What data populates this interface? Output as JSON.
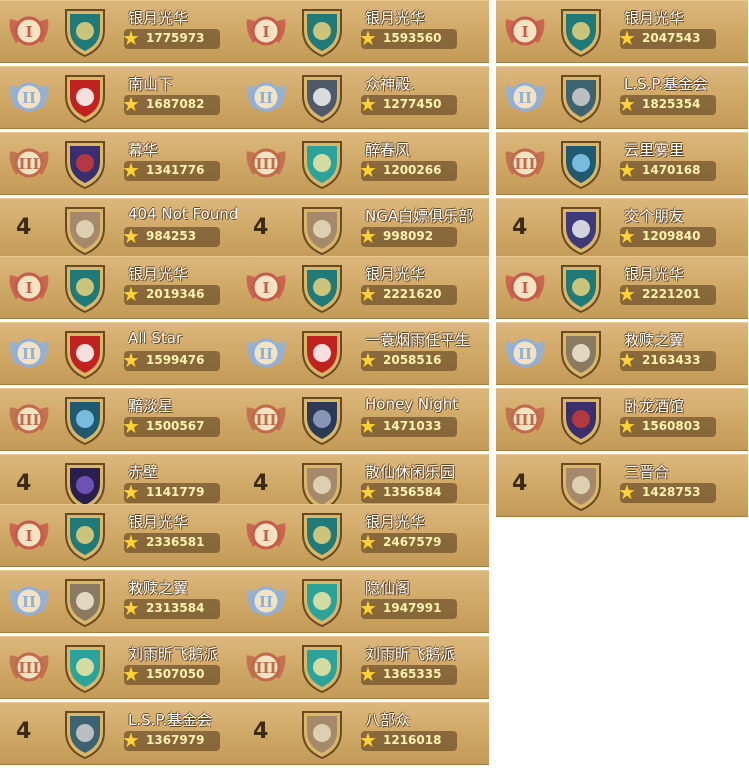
{
  "panels": [
    {
      "rows": [
        {
          "rank": "1",
          "name": "银月光华",
          "score": "1775973",
          "crest": "witch-crest"
        },
        {
          "rank": "2",
          "name": "南山下",
          "score": "1687082",
          "crest": "dragon-crest"
        },
        {
          "rank": "3",
          "name": "幕华",
          "score": "1341776",
          "crest": "flame-crest"
        },
        {
          "rank": "4",
          "name": "404 Not Found",
          "score": "984253",
          "crest": "crown-crest"
        }
      ]
    },
    {
      "rows": [
        {
          "rank": "1",
          "name": "银月光华",
          "score": "1593560",
          "crest": "witch-crest"
        },
        {
          "rank": "2",
          "name": "众神殿.",
          "score": "1277450",
          "crest": "panda-crest"
        },
        {
          "rank": "3",
          "name": "醉春风",
          "score": "1200266",
          "crest": "harp-crest"
        },
        {
          "rank": "4",
          "name": "NGA白嫖俱乐部",
          "score": "998092",
          "crest": "crown-crest"
        }
      ]
    },
    {
      "rows": [
        {
          "rank": "1",
          "name": "银月光华",
          "score": "2047543",
          "crest": "witch-crest"
        },
        {
          "rank": "2",
          "name": "L.S.P.基金会",
          "score": "1825354",
          "crest": "knight-crest"
        },
        {
          "rank": "3",
          "name": "云里雾里",
          "score": "1470168",
          "crest": "flower-crest"
        },
        {
          "rank": "4",
          "name": "交个朋友",
          "score": "1209840",
          "crest": "rocket-crest"
        }
      ]
    },
    {
      "rows": [
        {
          "rank": "1",
          "name": "银月光华",
          "score": "2019346",
          "crest": "witch-crest"
        },
        {
          "rank": "2",
          "name": "All Star",
          "score": "1599476",
          "crest": "dragon-crest"
        },
        {
          "rank": "3",
          "name": "黯淡星",
          "score": "1500567",
          "crest": "flower-crest"
        },
        {
          "rank": "4",
          "name": "赤壁",
          "score": "1141779",
          "crest": "wolf-crest"
        }
      ]
    },
    {
      "rows": [
        {
          "rank": "1",
          "name": "银月光华",
          "score": "2221620",
          "crest": "witch-crest"
        },
        {
          "rank": "2",
          "name": "一蓑烟雨任平生",
          "score": "2058516",
          "crest": "dragon-crest"
        },
        {
          "rank": "3",
          "name": "Honey Night",
          "score": "1471033",
          "crest": "mask-crest"
        },
        {
          "rank": "4",
          "name": "散仙休闲乐园",
          "score": "1356584",
          "crest": "crown-crest"
        }
      ]
    },
    {
      "rows": [
        {
          "rank": "1",
          "name": "银月光华",
          "score": "2221201",
          "crest": "witch-crest"
        },
        {
          "rank": "2",
          "name": "救赎之翼",
          "score": "2163433",
          "crest": "owl-crest"
        },
        {
          "rank": "3",
          "name": "卧龙酒馆",
          "score": "1560803",
          "crest": "demon-crest"
        },
        {
          "rank": "4",
          "name": "三晋合",
          "score": "1428753",
          "crest": "crown-crest"
        }
      ]
    },
    {
      "rows": [
        {
          "rank": "1",
          "name": "银月光华",
          "score": "2336581",
          "crest": "witch-crest"
        },
        {
          "rank": "2",
          "name": "救赎之翼",
          "score": "2313584",
          "crest": "owl-crest"
        },
        {
          "rank": "3",
          "name": "刘雨昕飞鹅派",
          "score": "1507050",
          "crest": "harp-crest"
        },
        {
          "rank": "4",
          "name": "L.S.P.基金会",
          "score": "1367979",
          "crest": "knight-crest"
        }
      ]
    },
    {
      "rows": [
        {
          "rank": "1",
          "name": "银月光华",
          "score": "2467579",
          "crest": "witch-crest"
        },
        {
          "rank": "2",
          "name": "隐仙阁",
          "score": "1947991",
          "crest": "harp-crest"
        },
        {
          "rank": "3",
          "name": "刘雨昕飞鹅派",
          "score": "1365335",
          "crest": "harp-crest"
        },
        {
          "rank": "4",
          "name": "八部众",
          "score": "1216018",
          "crest": "crown-crest"
        }
      ]
    }
  ]
}
